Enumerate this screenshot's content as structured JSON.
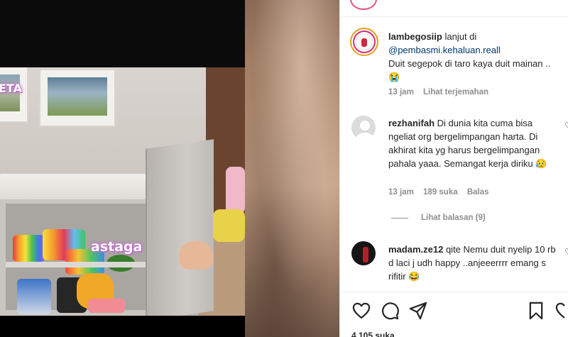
{
  "post": {
    "author": "lambegosiip",
    "caption_prefix": "lanjut di",
    "mention": "@pembasmi.kehaluan.reall",
    "caption_body": "Duit segepok di taro kaya duit mainan .. 😭",
    "time": "13 jam",
    "translate_label": "Lihat terjemahan"
  },
  "comments": [
    {
      "username": "rezhanifah",
      "text": "Di dunia kita cuma bisa ngeliat org bergelimpangan harta. Di akhirat kita yg harus bergelimpangan pahala yaaa. Semangat kerja diriku 😥",
      "time": "13 jam",
      "likes": "189 suka",
      "reply_label": "Balas",
      "view_replies": "Lihat balasan (9)"
    },
    {
      "username": "madam.ze12",
      "text": "qite Nemu duit nyelip 10 rb d laci j udh happy ..anjeeerrrr emang s rifitir 😂"
    }
  ],
  "footer": {
    "likes_partial": "4.105 suka"
  },
  "video": {
    "sticker_top": "ETA",
    "sticker_main": "astaga"
  },
  "icons": [
    "heart-icon",
    "comment-icon",
    "share-icon",
    "bookmark-icon",
    "heart-outline-small-icon"
  ],
  "colors": {
    "text": "#262626",
    "secondary": "#8e8e8e",
    "link": "#00376b",
    "story_ring": "#d82c72"
  }
}
